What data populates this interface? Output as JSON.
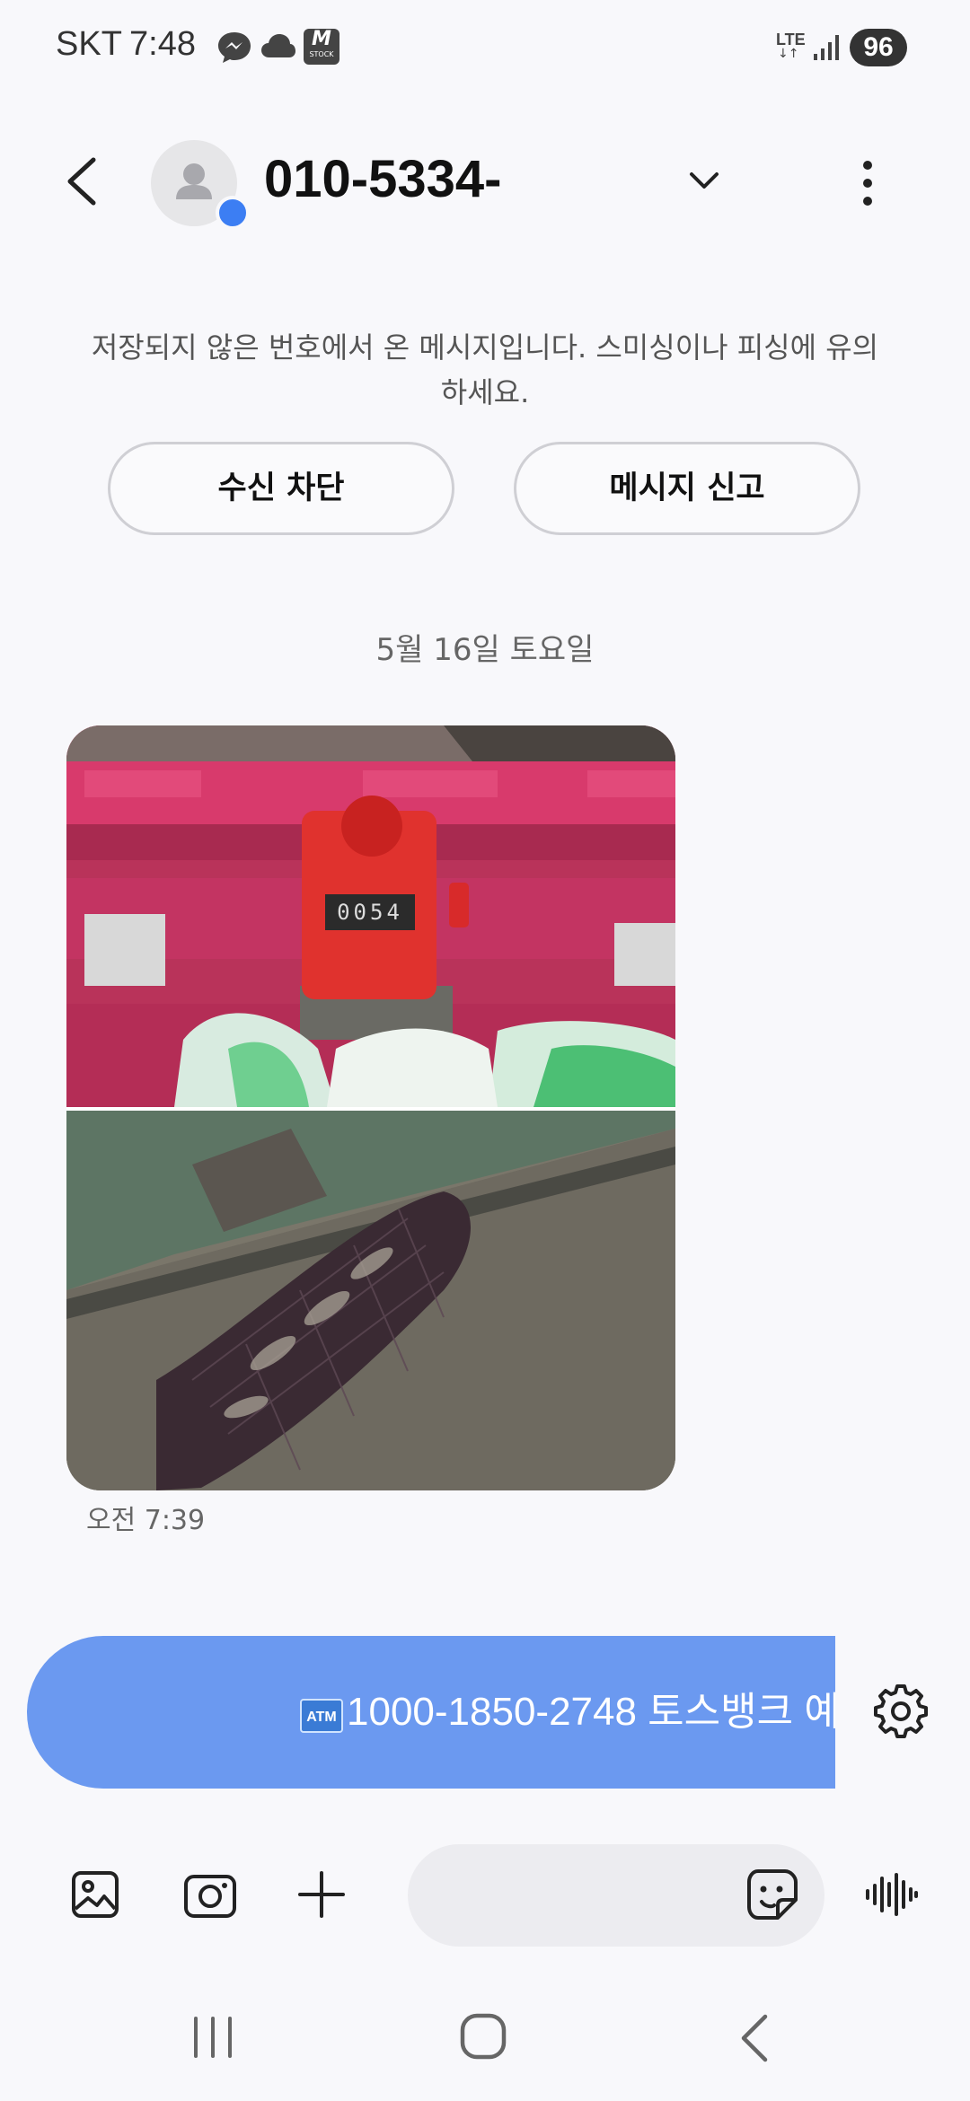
{
  "status_bar": {
    "carrier": "SKT",
    "time": "7:48",
    "stock_badge_letter": "M",
    "stock_badge_sub": "STOCK",
    "network": "LTE",
    "network_arrows": "↓↑",
    "battery": "96",
    "icons": [
      "messenger-icon",
      "cloud-icon",
      "stock-app-icon",
      "signal-icon"
    ]
  },
  "header": {
    "contact_number": "010-5334-",
    "icons": [
      "back-icon",
      "contact-avatar-icon",
      "chevron-down-icon",
      "more-vertical-icon"
    ]
  },
  "warning": {
    "text": "저장되지 않은 번호에서 온 메시지입니다. 스미싱이나 피싱에 유의하세요.",
    "block_label": "수신 차단",
    "report_label": "메시지 신고"
  },
  "conversation": {
    "date_divider": "5월 16일 토요일",
    "messages": [
      {
        "type": "image",
        "images": [
          "tally-counter-photo",
          "fish-keepnet-photo"
        ],
        "counter_reading": "0054",
        "time": "오전 7:39"
      }
    ]
  },
  "compose": {
    "draft_icon_label": "ATM",
    "draft_text": "1000-1850-2748 토스뱅크 예",
    "icons": [
      "settings-icon",
      "gallery-icon",
      "camera-icon",
      "plus-icon",
      "sticker-icon",
      "voice-icon"
    ]
  },
  "nav_bar": {
    "icons": [
      "recent-apps-icon",
      "home-icon",
      "back-nav-icon"
    ]
  },
  "colors": {
    "accent_blue": "#3c7ef3",
    "compose_bubble": "#6b99f0",
    "background": "#f8f8fb"
  }
}
